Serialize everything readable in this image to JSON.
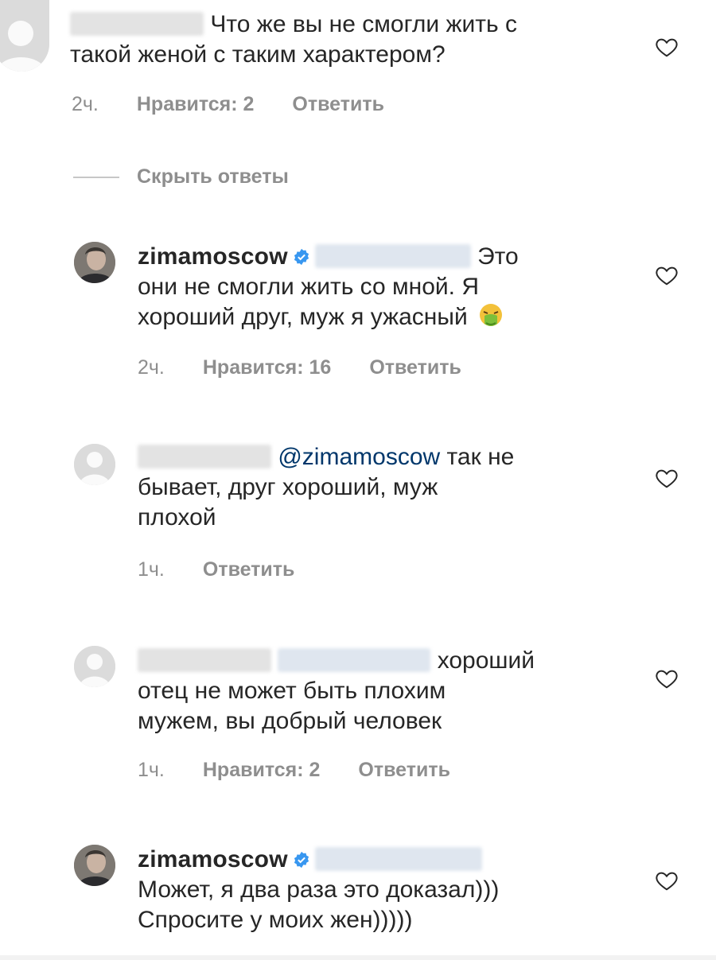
{
  "comments": [
    {
      "text": "Что же вы не смогли жить с такой женой с таким характером?",
      "text_line1": "Что же вы не смогли жить с",
      "text_line2": "такой женой с таким характером?",
      "time": "2ч.",
      "likes": "Нравится: 2",
      "reply": "Ответить"
    },
    {
      "username": "zimamoscow",
      "text_line1_end": "Это",
      "text_line2": "они не смогли жить со мной. Я",
      "text_line3": "хороший друг, муж я ужасный",
      "time": "2ч.",
      "likes": "Нравится: 16",
      "reply": "Ответить"
    },
    {
      "mention": "@zimamoscow",
      "text_line1_end": "так не",
      "text_line2": "бывает, друг хороший, муж",
      "text_line3": "плохой",
      "time": "1ч.",
      "reply": "Ответить"
    },
    {
      "text_line1_end": "хороший",
      "text_line2": "отец не может быть плохим",
      "text_line3": "мужем, вы добрый человек",
      "time": "1ч.",
      "likes": "Нравится: 2",
      "reply": "Ответить"
    },
    {
      "username": "zimamoscow",
      "text_line2": "Может, я два раза  это доказал)))",
      "text_line3": "Спросите у моих жен)))))"
    }
  ],
  "hide_replies": "Скрыть ответы",
  "icons": {
    "like": "heart-outline-icon",
    "verified": "verified-badge-icon",
    "emoji": "nauseated-face-emoji"
  },
  "colors": {
    "text": "#262626",
    "meta": "#8e8e8e",
    "mention": "#00376b",
    "verified": "#3897f0"
  }
}
